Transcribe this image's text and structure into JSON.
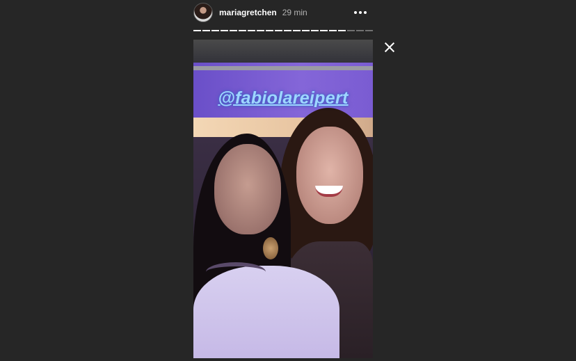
{
  "header": {
    "username": "mariagretchen",
    "time": "29 min"
  },
  "progress": {
    "segments_total": 20,
    "segments_viewed": 17
  },
  "story": {
    "mention": "@fabiolareipert"
  },
  "icons": {
    "more": "more-options-icon",
    "close": "close-icon"
  },
  "colors": {
    "background": "#262626",
    "mention_text": "#9fd6ff"
  }
}
